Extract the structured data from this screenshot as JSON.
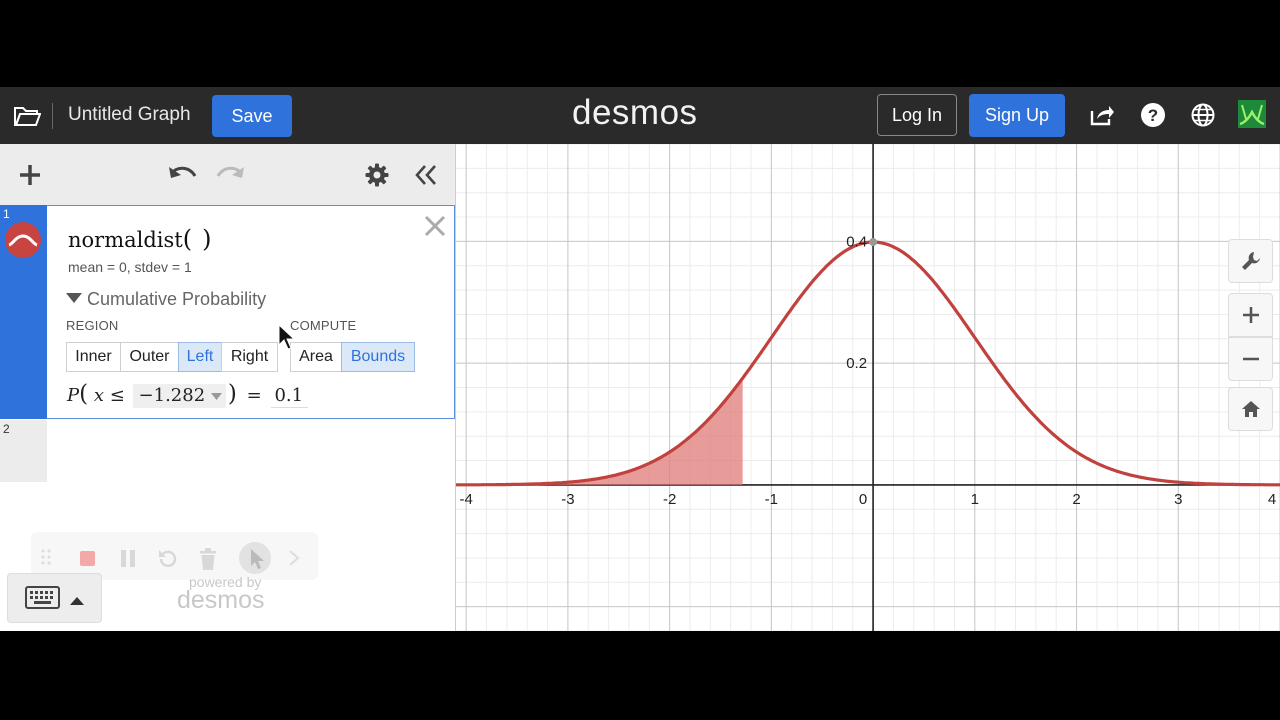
{
  "header": {
    "title": "Untitled Graph",
    "save_label": "Save",
    "logo": "desmos",
    "login_label": "Log In",
    "signup_label": "Sign Up"
  },
  "toolbar": {
    "add_icon": "plus-icon",
    "undo_icon": "undo-icon",
    "redo_icon": "redo-icon",
    "settings_icon": "gear-icon",
    "collapse_icon": "double-chevron-left-icon"
  },
  "expressions": [
    {
      "number": "1",
      "function": "normaldist",
      "open_paren": "(",
      "close_paren": ")",
      "params": "mean = 0,  stdev = 1",
      "section_label": "Cumulative Probability",
      "region_label": "REGION",
      "region_options": [
        "Inner",
        "Outer",
        "Left",
        "Right"
      ],
      "region_selected": "Left",
      "compute_label": "COMPUTE",
      "compute_options": [
        "Area",
        "Bounds"
      ],
      "compute_selected": "Bounds",
      "prob_prefix": "P",
      "prob_var": "x ≤",
      "bound_value": "−1.282",
      "equals": "=",
      "result": "0.1",
      "color": "#c74440"
    },
    {
      "number": "2"
    }
  ],
  "footer": {
    "powered_by": "powered by",
    "powered_logo": "desmos"
  },
  "graph": {
    "curve_color": "#c0413d",
    "shade_color": "#e07b78",
    "axis_color": "#222222",
    "grid_major_color": "#c8c8c8",
    "grid_minor_color": "#ececec",
    "x_ticks": [
      "-4",
      "-3",
      "-2",
      "-1",
      "0",
      "1",
      "2",
      "3",
      "4"
    ],
    "y_ticks": [
      "0.2",
      "0.4"
    ],
    "x_range": [
      -4.1,
      4.0
    ],
    "y_range": [
      -0.24,
      0.56
    ],
    "shade_upper_bound": -1.282
  },
  "right_controls": [
    "wrench-icon",
    "zoom-in-icon",
    "zoom-out-icon",
    "home-icon"
  ]
}
